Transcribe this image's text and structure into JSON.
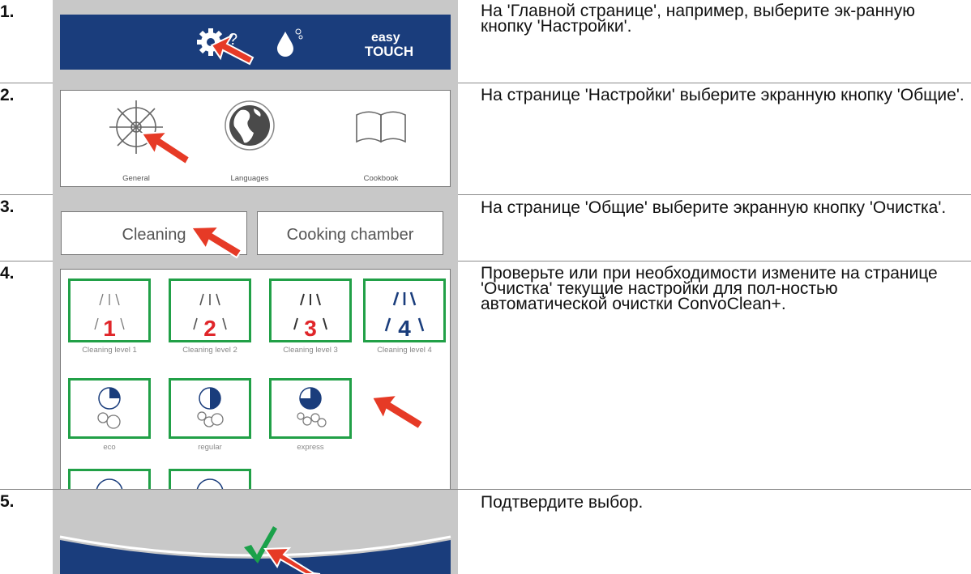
{
  "steps": [
    {
      "number": "1.",
      "text": "На 'Главной странице', например, выберите эк-ранную кнопку 'Настройки'.",
      "screen": {
        "logo_line1": "easy",
        "logo_line2": "TOUCH",
        "question_mark": "?"
      }
    },
    {
      "number": "2.",
      "text": "На странице 'Настройки' выберите экранную кнопку 'Общие'.",
      "screen": {
        "items": [
          "General",
          "Languages",
          "Cookbook"
        ]
      }
    },
    {
      "number": "3.",
      "text": "На странице 'Общие' выберите экранную кнопку 'Очистка'.",
      "screen": {
        "buttons": [
          "Cleaning",
          "Cooking chamber"
        ]
      }
    },
    {
      "number": "4.",
      "text": "Проверьте или при необходимости измените на странице 'Очистка' текущие настройки для пол-ностью автоматической очистки ConvoClean+.",
      "screen": {
        "levels": [
          {
            "digit": "1",
            "label": "Cleaning level 1"
          },
          {
            "digit": "2",
            "label": "Cleaning level 2"
          },
          {
            "digit": "3",
            "label": "Cleaning level 3"
          },
          {
            "digit": "4",
            "label": "Cleaning level 4"
          }
        ],
        "modes": [
          {
            "label": "eco",
            "fill": 0.25
          },
          {
            "label": "regular",
            "fill": 0.5
          },
          {
            "label": "express",
            "fill": 0.75
          }
        ]
      }
    },
    {
      "number": "5.",
      "text": "Подтвердите выбор.",
      "screen": {
        "icon": "confirm-check-icon"
      }
    }
  ],
  "colors": {
    "arrow": "#e63a26",
    "brand_blue": "#1a3d7c",
    "green": "#21a047",
    "red_digit": "#e0262a",
    "blue_digit": "#1a3d7c"
  }
}
